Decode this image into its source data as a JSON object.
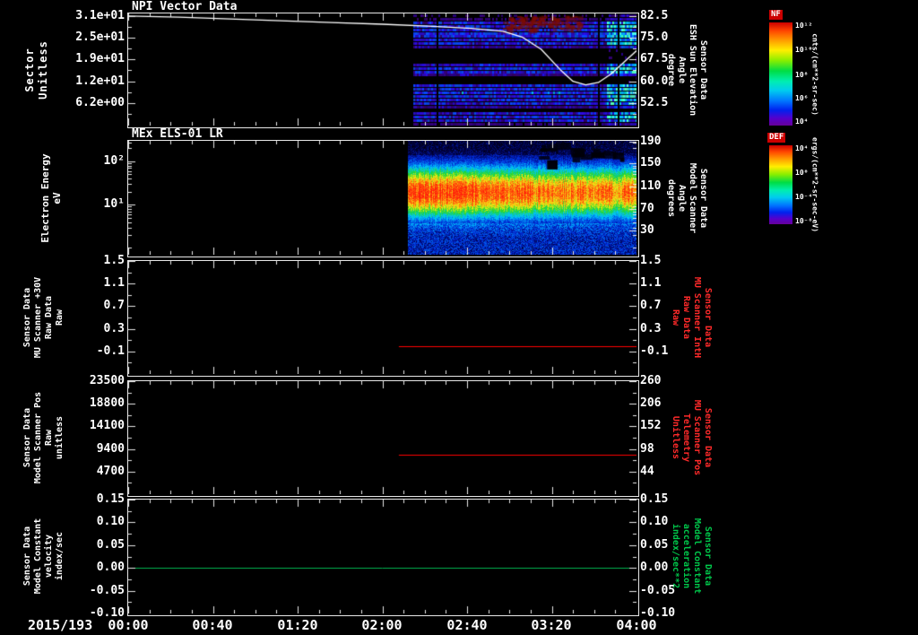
{
  "figure": {
    "background": "#000000",
    "foreground": "#ffffff"
  },
  "xaxis": {
    "date": "2015/193",
    "ticks": [
      "00:00",
      "00:40",
      "01:20",
      "02:00",
      "02:40",
      "03:20",
      "04:00"
    ]
  },
  "colorbars": [
    {
      "label": "NF",
      "units": "cnts/(cm**2-sr-sec)",
      "ticks": [
        "10¹²",
        "10¹⁰",
        "10⁸",
        "10⁶",
        "10⁴"
      ],
      "tick_fracs": [
        0.03,
        0.26,
        0.5,
        0.73,
        0.96
      ]
    },
    {
      "label": "DEF",
      "units": "ergs/(cm**2-sr-sec-eV)",
      "ticks": [
        "10⁴",
        "10⁰",
        "10⁻⁴",
        "10⁻⁸"
      ],
      "tick_fracs": [
        0.03,
        0.34,
        0.65,
        0.96
      ]
    }
  ],
  "chart_data": [
    {
      "type": "heatmap",
      "title": "NPI Vector Data",
      "left_axis": {
        "label": [
          "Sector",
          "Unitless"
        ],
        "ticks": [
          "3.1e+01",
          "2.5e+01",
          "1.9e+01",
          "1.2e+01",
          "6.2e+00"
        ],
        "tick_fracs": [
          0.02,
          0.215,
          0.41,
          0.605,
          0.8
        ],
        "range_top_bottom": [
          32,
          0
        ]
      },
      "right_axis": {
        "label": [
          "Sensor Data",
          "ESH Sun Elevation",
          "Angle",
          "degree"
        ],
        "ticks": [
          "82.5",
          "75.0",
          "67.5",
          "60.0",
          "52.5"
        ],
        "tick_fracs": [
          0.02,
          0.215,
          0.41,
          0.605,
          0.8
        ],
        "color": "#ffffff"
      },
      "minor_fracs": [
        0.1175,
        0.3125,
        0.5075,
        0.7025,
        0.8975
      ],
      "x_range_hours": [
        0,
        4
      ],
      "data_start_hour": 2.24,
      "spectrogram": {
        "style": "npi-sectors",
        "rows": 32,
        "palette": "blue-purple",
        "bright_edge_from_hour": 3.77,
        "row_profile": [
          0.15,
          0.25,
          0.9,
          1,
          0.95,
          1,
          0.9,
          0.85,
          0.9,
          0.4,
          0.05,
          0.05,
          0.05,
          0.05,
          0.7,
          1,
          0.9,
          0.4,
          0.05,
          0.05,
          0.9,
          1,
          1.05,
          1,
          0.95,
          0.9,
          0.4,
          0.05,
          0.7,
          0.9,
          0.8,
          0.3
        ]
      },
      "overlay_line": {
        "name": "ESH Sun Elevation Angle",
        "color": "#ffffff",
        "range_top_bottom": [
          83.3,
          44.8
        ],
        "points": [
          [
            0,
            82.4
          ],
          [
            0.4,
            82.0
          ],
          [
            0.8,
            81.4
          ],
          [
            1.2,
            80.8
          ],
          [
            1.6,
            80.2
          ],
          [
            2.0,
            79.6
          ],
          [
            2.4,
            78.9
          ],
          [
            2.7,
            78.2
          ],
          [
            2.95,
            77.2
          ],
          [
            3.1,
            75.2
          ],
          [
            3.25,
            71.0
          ],
          [
            3.4,
            64.0
          ],
          [
            3.5,
            60.0
          ],
          [
            3.6,
            58.8
          ],
          [
            3.7,
            59.6
          ],
          [
            3.8,
            62.5
          ],
          [
            3.9,
            66.5
          ],
          [
            4.0,
            70.5
          ]
        ]
      }
    },
    {
      "type": "heatmap",
      "title": "MEx ELS-01 LR",
      "left_axis": {
        "label": [
          "Electron Energy",
          "eV"
        ],
        "ticks": [
          "10²",
          "10¹"
        ],
        "tick_fracs": [
          0.18,
          0.56
        ],
        "scale": "log"
      },
      "right_axis": {
        "label": [
          "Sensor Data",
          "Model Scanner",
          "Angle",
          "degrees"
        ],
        "ticks": [
          "190",
          "150",
          "110",
          "70",
          "30"
        ],
        "tick_fracs": [
          0.01,
          0.2,
          0.4,
          0.6,
          0.79
        ],
        "color": "#ffffff"
      },
      "minor_fracs": [
        0.018,
        0.066,
        0.197,
        0.217,
        0.239,
        0.264,
        0.294,
        0.331,
        0.379,
        0.446,
        0.577,
        0.599,
        0.621,
        0.646,
        0.676,
        0.713,
        0.761,
        0.827,
        0.94
      ],
      "x_range_hours": [
        0,
        4
      ],
      "data_start_hour": 2.2,
      "spectrogram": {
        "style": "els-energy",
        "palette": "rainbow",
        "band_center_frac": 0.45,
        "band_sigma_frac": 0.13,
        "peak_hours": [
          2.2,
          3.0
        ]
      }
    },
    {
      "type": "line",
      "left_axis": {
        "label": [
          "Sensor Data",
          "MU Scanner +30V",
          "Raw Data",
          "Raw"
        ],
        "ticks": [
          "1.5",
          "1.1",
          "0.7",
          "0.3",
          "-0.1"
        ],
        "tick_fracs": [
          0,
          0.2,
          0.4,
          0.6,
          0.8
        ],
        "range_top_bottom": [
          1.5,
          -0.5
        ]
      },
      "right_axis": {
        "label": [
          "Sensor Data",
          "MU Scanner IntH",
          "Raw Data",
          "Raw"
        ],
        "ticks": [
          "1.5",
          "1.1",
          "0.7",
          "0.3",
          "-0.1"
        ],
        "tick_fracs": [
          0,
          0.2,
          0.4,
          0.6,
          0.8
        ],
        "color": "#ff2a2a"
      },
      "minor_fracs": [
        0.1,
        0.3,
        0.5,
        0.7,
        0.9
      ],
      "x_range_hours": [
        0,
        4
      ],
      "series": [
        {
          "name": "MU Scanner IntH Raw",
          "color": "#ff0000",
          "start_hour": 2.13,
          "end_hour": 4,
          "value": 0.0
        }
      ]
    },
    {
      "type": "line",
      "left_axis": {
        "label": [
          "Sensor Data",
          "Model Scanner Pos",
          "Raw",
          "unitless"
        ],
        "ticks": [
          "23500",
          "18800",
          "14100",
          "9400",
          "4700"
        ],
        "tick_fracs": [
          0,
          0.2,
          0.4,
          0.6,
          0.8
        ],
        "range_top_bottom": [
          23500,
          0
        ]
      },
      "right_axis": {
        "label": [
          "Sensor Data",
          "MU Scanner Pos",
          "Telemetry",
          "Unitless"
        ],
        "ticks": [
          "260",
          "206",
          "152",
          "98",
          "44"
        ],
        "tick_fracs": [
          0,
          0.2,
          0.4,
          0.6,
          0.8
        ],
        "color": "#ff2a2a"
      },
      "minor_fracs": [
        0.1,
        0.3,
        0.5,
        0.7,
        0.9
      ],
      "x_range_hours": [
        0,
        4
      ],
      "series": [
        {
          "name": "Model Scanner Pos Raw",
          "color": "#ff0000",
          "start_hour": 2.13,
          "end_hour": 4,
          "value": 8200
        }
      ]
    },
    {
      "type": "line",
      "left_axis": {
        "label": [
          "Sensor Data",
          "Model Constant",
          "velocity",
          "index/sec"
        ],
        "ticks": [
          "0.15",
          "0.10",
          "0.05",
          "0.00",
          "-0.05",
          "-0.10"
        ],
        "tick_fracs": [
          0,
          0.2,
          0.4,
          0.6,
          0.8,
          1
        ],
        "range_top_bottom": [
          0.15,
          -0.1
        ]
      },
      "right_axis": {
        "label": [
          "Sensor Data",
          "Model Constant",
          "acceleration",
          "index/sec**2"
        ],
        "ticks": [
          "0.15",
          "0.10",
          "0.05",
          "0.00",
          "-0.05",
          "-0.10"
        ],
        "tick_fracs": [
          0,
          0.2,
          0.4,
          0.6,
          0.8,
          1
        ],
        "color": "#00c84b"
      },
      "minor_fracs": [
        0.1,
        0.3,
        0.5,
        0.7,
        0.9
      ],
      "x_range_hours": [
        0,
        4
      ],
      "series": [
        {
          "name": "Model Constant velocity",
          "color": "#00b450",
          "start_hour": 0,
          "end_hour": 4,
          "value": 0.0
        }
      ]
    }
  ]
}
